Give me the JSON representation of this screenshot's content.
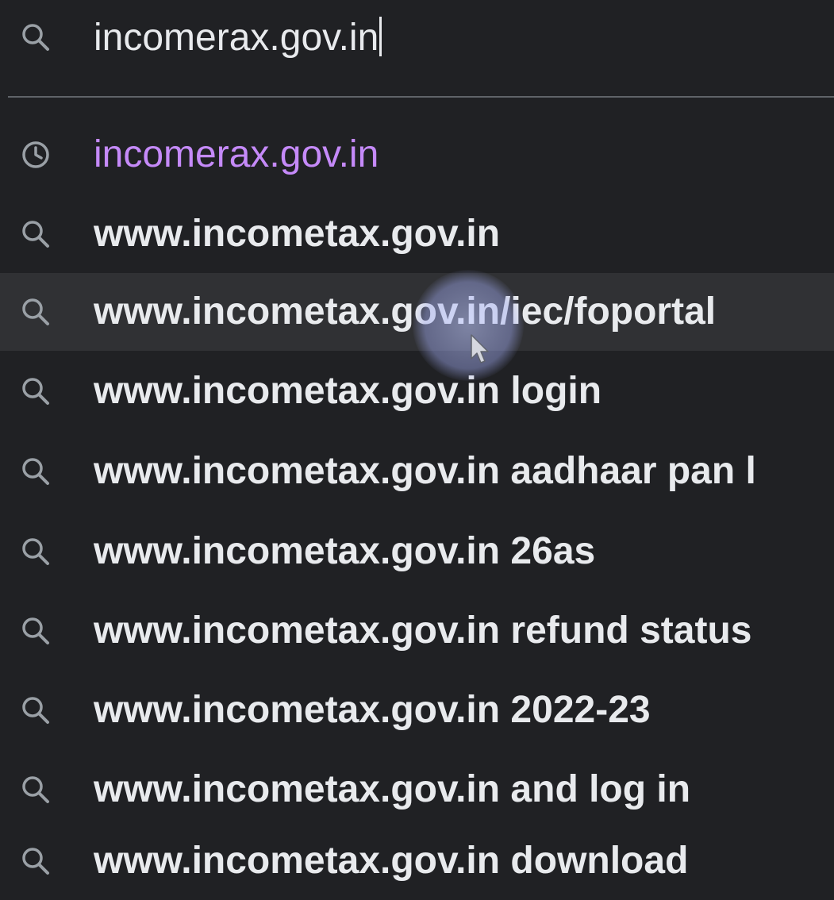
{
  "omnibox": {
    "input_value": "incomerax.gov.in",
    "input_icon": "search-icon"
  },
  "suggestions": [
    {
      "text": "incomerax.gov.in",
      "icon": "history-clock-icon",
      "type": "history"
    },
    {
      "text": "www.incometax.gov.in",
      "icon": "search-icon",
      "type": "search"
    },
    {
      "text": "www.incometax.gov.in/iec/foportal",
      "icon": "search-icon",
      "type": "search",
      "hovered": true
    },
    {
      "text": "www.incometax.gov.in login",
      "icon": "search-icon",
      "type": "search"
    },
    {
      "text": "www.incometax.gov.in aadhaar pan l",
      "icon": "search-icon",
      "type": "search"
    },
    {
      "text": "www.incometax.gov.in 26as",
      "icon": "search-icon",
      "type": "search"
    },
    {
      "text": "www.incometax.gov.in refund status",
      "icon": "search-icon",
      "type": "search"
    },
    {
      "text": "www.incometax.gov.in 2022-23",
      "icon": "search-icon",
      "type": "search"
    },
    {
      "text": "www.incometax.gov.in and log in",
      "icon": "search-icon",
      "type": "search"
    },
    {
      "text": "www.incometax.gov.in download",
      "icon": "search-icon",
      "type": "search"
    }
  ],
  "colors": {
    "background": "#202124",
    "hover_row": "#303134",
    "text": "#e8eaed",
    "visited_link": "#c58af9",
    "icon": "#9aa0a6",
    "divider": "#5f6368"
  }
}
